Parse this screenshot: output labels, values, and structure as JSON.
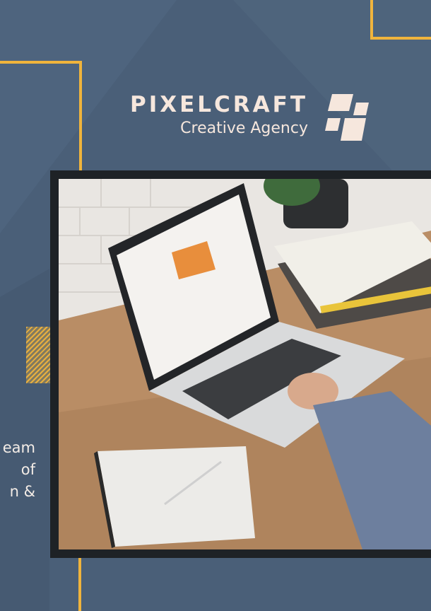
{
  "brand": {
    "name": "PIXELCRAFT",
    "tagline": "Creative Agency",
    "logo_icon": "stacked-tiles-icon"
  },
  "side_text": {
    "lines": [
      "eam",
      "of",
      "n &"
    ]
  },
  "colors": {
    "background": "#4a5f78",
    "accent": "#f0b43c",
    "text": "#f6e7dd",
    "photo_frame": "#1e2226"
  },
  "photo": {
    "subject": "person using laptop on wooden desk"
  }
}
